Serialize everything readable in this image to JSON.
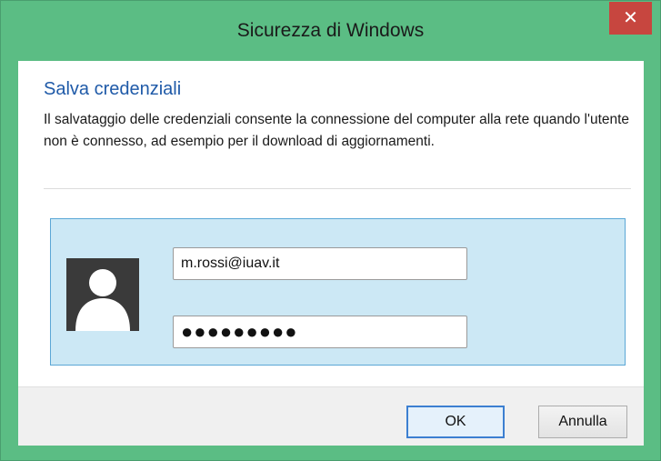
{
  "window": {
    "title": "Sicurezza di Windows",
    "close_glyph": "✕"
  },
  "content": {
    "heading": "Salva credenziali",
    "description": "Il salvataggio delle credenziali consente la connessione del computer alla rete quando l'utente non è connesso, ad esempio per il download di aggiornamenti."
  },
  "credentials": {
    "avatar_icon": "user-avatar-icon",
    "username_value": "m.rossi@iuav.it",
    "password_mask": "●●●●●●●●●"
  },
  "buttons": {
    "ok_label": "OK",
    "cancel_label": "Annulla"
  },
  "colors": {
    "titlebar": "#5bbd84",
    "close_button": "#c7463f",
    "heading": "#1f5aa8",
    "credential_panel": "#cce8f5"
  }
}
